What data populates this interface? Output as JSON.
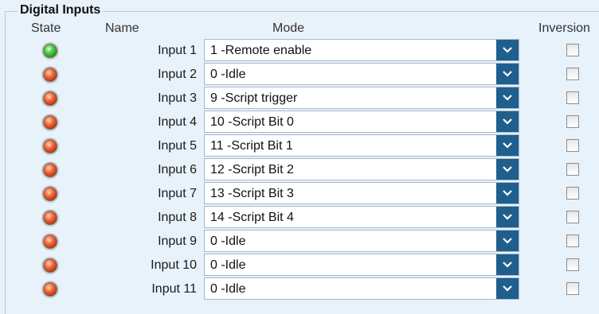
{
  "group": {
    "title": "Digital Inputs"
  },
  "headers": {
    "state": "State",
    "name": "Name",
    "mode": "Mode",
    "inversion": "Inversion"
  },
  "colors": {
    "led_on": "#4fd04a",
    "led_off": "#ef6233",
    "dropdown_button": "#1f5f8d",
    "background": "#e8f2fb"
  },
  "icons": {
    "dropdown": "chevron-down-icon",
    "state": "led-indicator-icon"
  },
  "inputs": [
    {
      "name": "Input 1",
      "state": "on",
      "mode": "1  -Remote enable",
      "inverted": false
    },
    {
      "name": "Input 2",
      "state": "off",
      "mode": "0  -Idle",
      "inverted": false
    },
    {
      "name": "Input 3",
      "state": "off",
      "mode": "9  -Script trigger",
      "inverted": false
    },
    {
      "name": "Input 4",
      "state": "off",
      "mode": "10  -Script Bit 0",
      "inverted": false
    },
    {
      "name": "Input 5",
      "state": "off",
      "mode": "11  -Script Bit 1",
      "inverted": false
    },
    {
      "name": "Input 6",
      "state": "off",
      "mode": "12  -Script Bit 2",
      "inverted": false
    },
    {
      "name": "Input 7",
      "state": "off",
      "mode": "13  -Script Bit 3",
      "inverted": false
    },
    {
      "name": "Input 8",
      "state": "off",
      "mode": "14  -Script Bit 4",
      "inverted": false
    },
    {
      "name": "Input 9",
      "state": "off",
      "mode": "0  -Idle",
      "inverted": false
    },
    {
      "name": "Input 10",
      "state": "off",
      "mode": "0  -Idle",
      "inverted": false
    },
    {
      "name": "Input 11",
      "state": "off",
      "mode": "0  -Idle",
      "inverted": false
    }
  ]
}
